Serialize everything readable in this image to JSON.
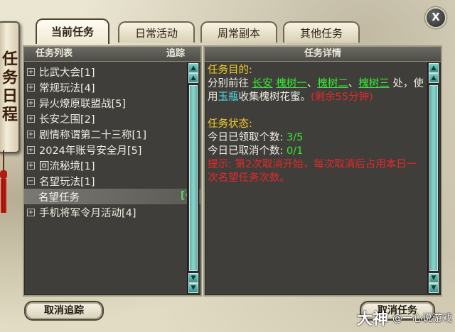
{
  "window": {
    "side_title": "任务日程",
    "close_label": "X"
  },
  "tabs": [
    {
      "label": "当前任务",
      "active": true
    },
    {
      "label": "日常活动",
      "active": false
    },
    {
      "label": "周常副本",
      "active": false
    },
    {
      "label": "其他任务",
      "active": false
    }
  ],
  "task_list": {
    "header": "任务列表",
    "track_header": "追踪",
    "items": [
      {
        "label": "比武大会[1]",
        "expander": "+"
      },
      {
        "label": "常规玩法[4]",
        "expander": "+"
      },
      {
        "label": "异火燎原联盟战[5]",
        "expander": "+"
      },
      {
        "label": "长安之围[2]",
        "expander": "+"
      },
      {
        "label": "剧情称谓第二十三称[1]",
        "expander": "+"
      },
      {
        "label": "2024年账号安全月[5]",
        "expander": "+"
      },
      {
        "label": "回流秘境[1]",
        "expander": "+"
      },
      {
        "label": "名望玩法[1]",
        "expander": "−"
      },
      {
        "label": "名望任务",
        "sub": true,
        "track": "[√]"
      },
      {
        "label": "手机将军令月活动[4]",
        "expander": "+"
      }
    ]
  },
  "details": {
    "header": "任务详情",
    "goal_title": "任务目的:",
    "goal_prefix": "分别前往 ",
    "loc_changan": "长安",
    "loc_1": "槐树一",
    "sep_1": "、",
    "loc_2": "槐树二",
    "sep_2": "、",
    "loc_3": "槐树三",
    "goal_mid": " 处，使用",
    "item": "玉瓶",
    "goal_end": "收集槐树花蜜。",
    "remaining": "(剩余55分钟)",
    "status_title": "任务状态:",
    "received_label": "今日已领取个数: ",
    "received_value": "3/5",
    "cancelled_label": "今日已取消个数: ",
    "cancelled_value": "0/1",
    "hint": "提示: 第2次取消开始，每次取消后占用本日一次名望任务次数。"
  },
  "buttons": {
    "cancel_track": "取消追踪",
    "cancel_task": "取消任务"
  },
  "watermark": {
    "brand": "大神",
    "text": "@一心说游戏"
  },
  "colors": {
    "title_yellow": "#f2cc2b",
    "highlight_green": "#36e836",
    "highlight_cyan": "#4fe3f0",
    "warning_red": "#e4292a",
    "panel_bg": "#403e3a"
  }
}
